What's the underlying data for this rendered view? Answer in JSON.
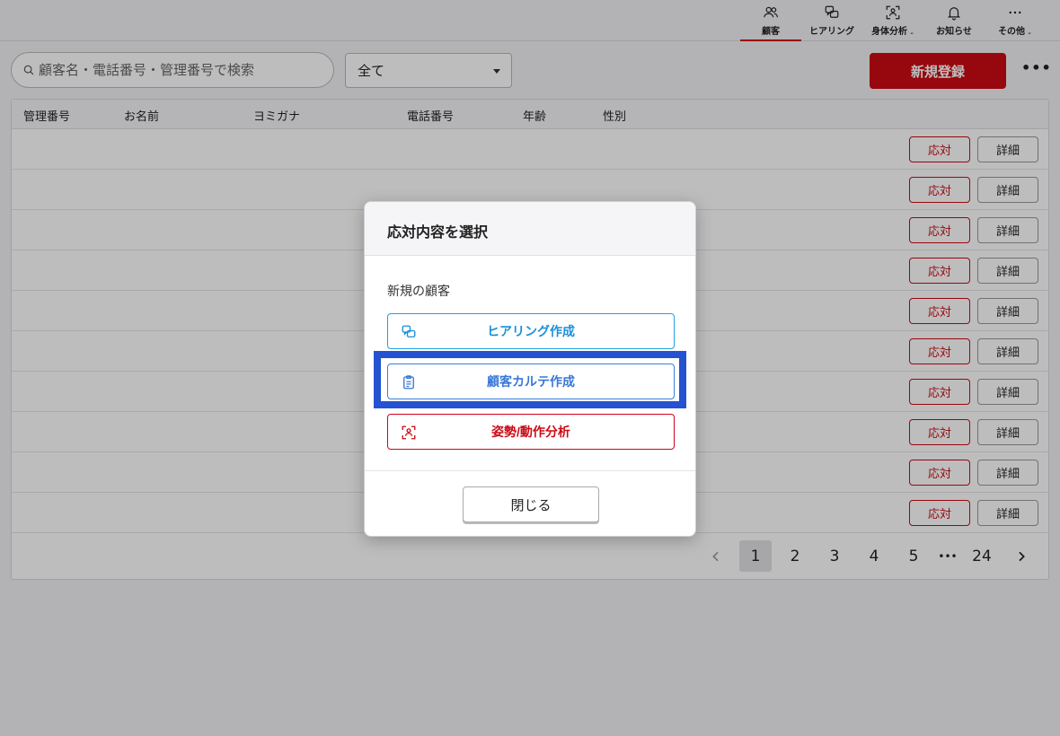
{
  "nav": {
    "items": [
      {
        "label": "顧客",
        "icon": "people-icon",
        "active": true
      },
      {
        "label": "ヒアリング",
        "icon": "chat-icon"
      },
      {
        "label": "身体分析",
        "icon": "body-scan-icon",
        "dropdown": true
      },
      {
        "label": "お知らせ",
        "icon": "bell-icon"
      },
      {
        "label": "その他",
        "icon": "more-icon",
        "dropdown": true
      }
    ]
  },
  "toolbar": {
    "search_placeholder": "顧客名・電話番号・管理番号で検索",
    "filter_value": "全て",
    "new_button": "新規登録"
  },
  "table": {
    "headers": [
      "管理番号",
      "お名前",
      "ヨミガナ",
      "電話番号",
      "年齢",
      "性別"
    ],
    "row_count": 10,
    "respond_label": "応対",
    "detail_label": "詳細"
  },
  "pagination": {
    "pages": [
      "1",
      "2",
      "3",
      "4",
      "5"
    ],
    "ellipsis": "•••",
    "last": "24",
    "current": "1"
  },
  "modal": {
    "title": "応対内容を選択",
    "section": "新規の顧客",
    "hearing_button": "ヒアリング作成",
    "karte_button": "顧客カルテ作成",
    "posture_button": "姿勢/動作分析",
    "close_button": "閉じる"
  },
  "colors": {
    "brand_red": "#cc0a14",
    "hearing_blue": "#1a8fd8",
    "karte_blue": "#3877d6",
    "highlight": "#2452d0"
  }
}
